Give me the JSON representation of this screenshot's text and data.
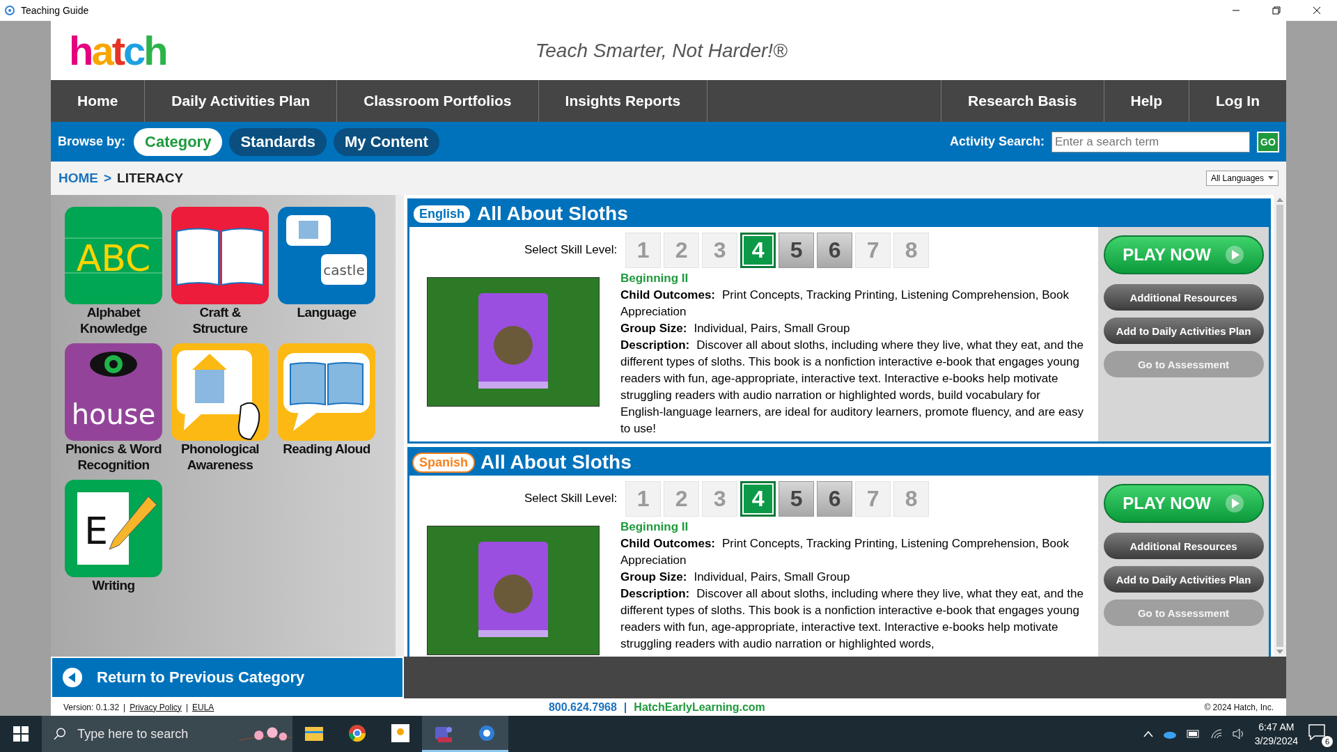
{
  "window": {
    "title": "Teaching Guide"
  },
  "header": {
    "logo": "hatch",
    "tagline": "Teach Smarter, Not Harder!®"
  },
  "nav": {
    "left": [
      "Home",
      "Daily Activities Plan",
      "Classroom Portfolios",
      "Insights Reports"
    ],
    "right": [
      "Research Basis",
      "Help",
      "Log In"
    ]
  },
  "browse": {
    "label": "Browse by:",
    "options": [
      {
        "label": "Category",
        "selected": true
      },
      {
        "label": "Standards",
        "selected": false
      },
      {
        "label": "My Content",
        "selected": false
      }
    ],
    "search_label": "Activity Search:",
    "search_placeholder": "Enter a search term",
    "go": "GO"
  },
  "breadcrumb": {
    "items": [
      "HOME",
      "LITERACY"
    ],
    "separator": ">"
  },
  "language_filter": "All Languages",
  "categories": [
    {
      "kind": "alphabet",
      "label": "Alphabet Knowledge",
      "art_text": "ABC"
    },
    {
      "kind": "craft",
      "label": "Craft & Structure"
    },
    {
      "kind": "language",
      "label": "Language",
      "art_text": "castle"
    },
    {
      "kind": "phonics",
      "label": "Phonics & Word Recognition",
      "art_text": "house"
    },
    {
      "kind": "phonological",
      "label": "Phonological Awareness"
    },
    {
      "kind": "reading",
      "label": "Reading Aloud"
    },
    {
      "kind": "writing",
      "label": "Writing",
      "art_text": "E"
    }
  ],
  "return_button": "Return to Previous Category",
  "activities": [
    {
      "language": "English",
      "color": "#0072bc",
      "title": "All About Sloths",
      "skill_label": "Select Skill Level:",
      "levels": [
        {
          "label": "1",
          "selected": false,
          "disabled": true
        },
        {
          "label": "2",
          "selected": false,
          "disabled": true
        },
        {
          "label": "3",
          "selected": false,
          "disabled": true
        },
        {
          "label": "4",
          "selected": true,
          "disabled": false
        },
        {
          "label": "5",
          "selected": false,
          "disabled": false
        },
        {
          "label": "6",
          "selected": false,
          "disabled": false
        },
        {
          "label": "7",
          "selected": false,
          "disabled": true
        },
        {
          "label": "8",
          "selected": false,
          "disabled": true
        }
      ],
      "level_name": "Beginning II",
      "fields": [
        {
          "label": "Child Outcomes:",
          "value": "Print Concepts, Tracking Printing, Listening Comprehension, Book Appreciation"
        },
        {
          "label": "Group Size:",
          "value": "Individual, Pairs, Small Group"
        },
        {
          "label": "Description:",
          "value": "Discover all about sloths, including where they live, what they eat, and the different types of sloths. This book is a nonfiction interactive e-book that engages young readers with fun, age-appropriate, interactive text. Interactive e-books help motivate struggling readers with audio narration or highlighted words, build vocabulary for English-language learners, are ideal for auditory learners, promote fluency, and are easy to use!"
        }
      ],
      "buttons": [
        {
          "kind": "play",
          "label": "PLAY NOW"
        },
        {
          "kind": "secondary",
          "label": "Additional Resources"
        },
        {
          "kind": "secondary",
          "label": "Add to Daily Activities Plan"
        },
        {
          "kind": "inactive",
          "label": "Go to Assessment"
        }
      ]
    },
    {
      "language": "Spanish",
      "color": "#f58220",
      "title": "All About Sloths",
      "skill_label": "Select Skill Level:",
      "levels": [
        {
          "label": "1",
          "selected": false,
          "disabled": true
        },
        {
          "label": "2",
          "selected": false,
          "disabled": true
        },
        {
          "label": "3",
          "selected": false,
          "disabled": true
        },
        {
          "label": "4",
          "selected": true,
          "disabled": false
        },
        {
          "label": "5",
          "selected": false,
          "disabled": false
        },
        {
          "label": "6",
          "selected": false,
          "disabled": false
        },
        {
          "label": "7",
          "selected": false,
          "disabled": true
        },
        {
          "label": "8",
          "selected": false,
          "disabled": true
        }
      ],
      "level_name": "Beginning II",
      "fields": [
        {
          "label": "Child Outcomes:",
          "value": "Print Concepts, Tracking Printing, Listening Comprehension, Book Appreciation"
        },
        {
          "label": "Group Size:",
          "value": "Individual, Pairs, Small Group"
        },
        {
          "label": "Description:",
          "value": "Discover all about sloths, including where they live, what they eat, and the different types of sloths. This book is a nonfiction interactive e-book that engages young readers with fun, age-appropriate, interactive text. Interactive e-books help motivate struggling readers with audio narration or highlighted words,"
        }
      ],
      "buttons": [
        {
          "kind": "play",
          "label": "PLAY NOW"
        },
        {
          "kind": "secondary",
          "label": "Additional Resources"
        },
        {
          "kind": "secondary",
          "label": "Add to Daily Activities Plan"
        },
        {
          "kind": "inactive",
          "label": "Go to Assessment"
        }
      ]
    }
  ],
  "footer": {
    "separator": "|",
    "version": "Version: 0.1.32",
    "links": [
      "Privacy Policy",
      "EULA"
    ],
    "phone": "800.624.7968",
    "site": "HatchEarlyLearning.com",
    "copyright": "© 2024 Hatch, Inc."
  },
  "taskbar": {
    "search_placeholder": "Type here to search",
    "time": "6:47 AM",
    "date": "3/29/2024",
    "notifications": "6"
  }
}
